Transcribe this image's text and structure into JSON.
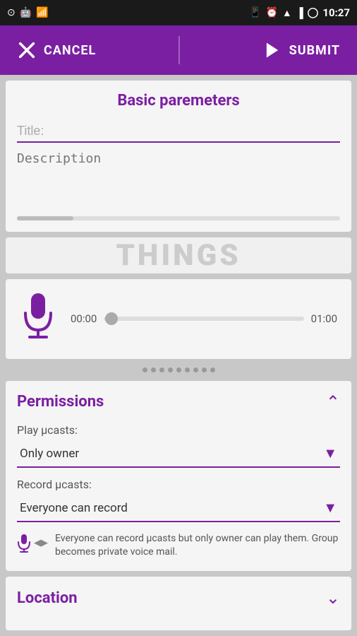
{
  "statusBar": {
    "time": "10:27",
    "icons": [
      "signal",
      "alarm",
      "wifi",
      "network",
      "sync"
    ]
  },
  "toolbar": {
    "cancel_label": "CANCEL",
    "submit_label": "SUBMIT"
  },
  "basicParams": {
    "section_title": "Basic paremeters",
    "title_placeholder": "Title:",
    "description_placeholder": "Description"
  },
  "thingsBanner": {
    "text": "THINGS"
  },
  "audio": {
    "time_start": "00:00",
    "time_end": "01:00"
  },
  "dots": [
    1,
    2,
    3,
    4,
    5,
    6,
    7,
    8,
    9
  ],
  "permissions": {
    "section_title": "Permissions",
    "play_label": "Play µcasts:",
    "play_value": "Only owner",
    "record_label": "Record µcasts:",
    "record_value": "Everyone can record",
    "info_text": "Everyone can record µcasts but only owner can play them. Group becomes private voice mail."
  },
  "location": {
    "section_title": "Location"
  }
}
